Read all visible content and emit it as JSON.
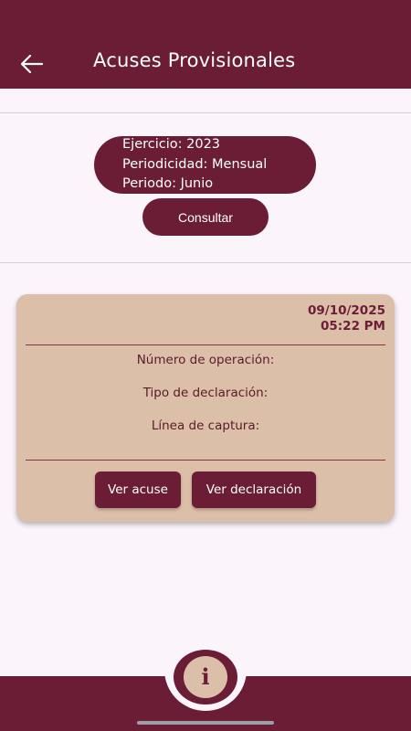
{
  "header": {
    "title": "Acuses Provisionales",
    "back_icon": "arrow-left-icon"
  },
  "filters": {
    "ejercicio": "Ejercicio: 2023",
    "periodicidad": "Periodicidad: Mensual",
    "periodo": "Periodo: Junio",
    "consultar_label": "Consultar"
  },
  "card": {
    "date": "09/10/2025",
    "time": "05:22 PM",
    "numero_operacion_label": "Número de operación:",
    "tipo_declaracion_label": "Tipo de declaración:",
    "linea_captura_label": "Línea de captura:",
    "ver_acuse_label": "Ver acuse",
    "ver_declaracion_label": "Ver declaración"
  },
  "bottom_nav": {
    "info_icon": "info-icon",
    "info_glyph": "i"
  },
  "colors": {
    "primary": "#6b1d35",
    "card_bg": "#dcbfa8",
    "page_bg": "#fcf4fb"
  }
}
